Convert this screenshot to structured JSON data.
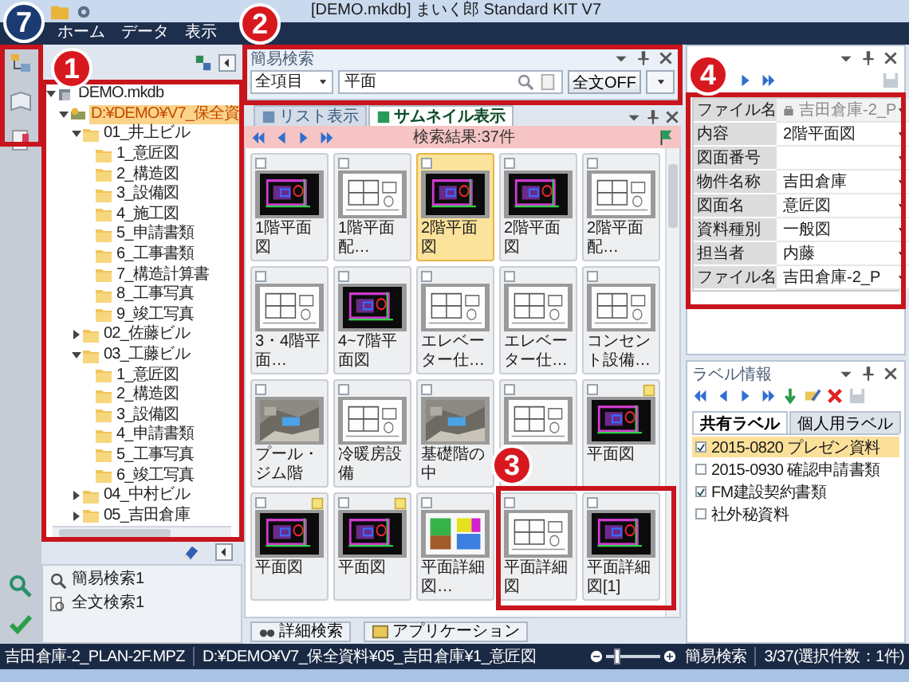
{
  "window": {
    "logo": "7",
    "title": "[DEMO.mkdb] まいく郎 Standard KIT V7"
  },
  "ribbon_tabs": [
    {
      "label": "ホーム",
      "selected": false
    },
    {
      "label": "データ",
      "selected": false
    },
    {
      "label": "表示",
      "selected": false
    }
  ],
  "tree": [
    {
      "label": "DEMO.mkdb",
      "kind": "db",
      "expanded": true,
      "selected": false,
      "children": [
        {
          "label": "D:¥DEMO¥V7_保全資",
          "kind": "drive",
          "expanded": true,
          "selected": true,
          "children": [
            {
              "label": "01_井上ビル",
              "kind": "folder",
              "expanded": true,
              "selected": false,
              "children": [
                {
                  "label": "1_意匠図",
                  "kind": "folder",
                  "selected": false
                },
                {
                  "label": "2_構造図",
                  "kind": "folder",
                  "selected": false
                },
                {
                  "label": "3_設備図",
                  "kind": "folder",
                  "selected": false
                },
                {
                  "label": "4_施工図",
                  "kind": "folder",
                  "selected": false
                },
                {
                  "label": "5_申請書類",
                  "kind": "folder",
                  "selected": false
                },
                {
                  "label": "6_工事書類",
                  "kind": "folder",
                  "selected": false
                },
                {
                  "label": "7_構造計算書",
                  "kind": "folder",
                  "selected": false
                },
                {
                  "label": "8_工事写真",
                  "kind": "folder",
                  "selected": false
                },
                {
                  "label": "9_竣工写真",
                  "kind": "folder",
                  "selected": false
                }
              ]
            },
            {
              "label": "02_佐藤ビル",
              "kind": "folder",
              "expanded": false,
              "selected": false
            },
            {
              "label": "03_工藤ビル",
              "kind": "folder",
              "expanded": true,
              "selected": false,
              "children": [
                {
                  "label": "1_意匠図",
                  "kind": "folder",
                  "selected": false
                },
                {
                  "label": "2_構造図",
                  "kind": "folder",
                  "selected": false
                },
                {
                  "label": "3_設備図",
                  "kind": "folder",
                  "selected": false
                },
                {
                  "label": "4_申請書類",
                  "kind": "folder",
                  "selected": false
                },
                {
                  "label": "5_工事写真",
                  "kind": "folder",
                  "selected": false
                },
                {
                  "label": "6_竣工写真",
                  "kind": "folder",
                  "selected": false
                }
              ]
            },
            {
              "label": "04_中村ビル",
              "kind": "folder",
              "expanded": false,
              "selected": false
            },
            {
              "label": "05_吉田倉庫",
              "kind": "folder",
              "expanded": false,
              "selected": false
            }
          ]
        }
      ]
    }
  ],
  "saved_searches": [
    {
      "label": "簡易検索1",
      "kind": "simple"
    },
    {
      "label": "全文検索1",
      "kind": "fulltext"
    }
  ],
  "search_panel": {
    "title": "簡易検索",
    "field": "全項目",
    "query": "平面",
    "fulltext_button": "全文OFF"
  },
  "view_tabs": [
    {
      "label": "リスト表示",
      "selected": false
    },
    {
      "label": "サムネイル表示",
      "selected": true
    }
  ],
  "result_count": "検索結果:37件",
  "thumbnails": [
    {
      "label": "1階平面図",
      "kind": "cad-dark",
      "selected": false,
      "checked": false,
      "note": false
    },
    {
      "label": "1階平面配…",
      "kind": "cad-white",
      "selected": false,
      "checked": false,
      "note": false
    },
    {
      "label": "2階平面図",
      "kind": "cad-dark",
      "selected": true,
      "checked": false,
      "note": false
    },
    {
      "label": "2階平面図",
      "kind": "cad-dark",
      "selected": false,
      "checked": false,
      "note": false
    },
    {
      "label": "2階平面配…",
      "kind": "cad-white",
      "selected": false,
      "checked": false,
      "note": false
    },
    {
      "label": "3・4階平面…",
      "kind": "cad-white",
      "selected": false,
      "checked": false,
      "note": false
    },
    {
      "label": "4~7階平面図",
      "kind": "cad-dark",
      "selected": false,
      "checked": false,
      "note": false
    },
    {
      "label": "エレベーター仕…",
      "kind": "cad-white",
      "selected": false,
      "checked": false,
      "note": false
    },
    {
      "label": "エレベーター仕…",
      "kind": "cad-white",
      "selected": false,
      "checked": false,
      "note": false
    },
    {
      "label": "コンセント設備…",
      "kind": "cad-white",
      "selected": false,
      "checked": false,
      "note": false
    },
    {
      "label": "プール・ジム階",
      "selected": false,
      "checked": false,
      "note": false
    },
    {
      "label": "冷暖房設備",
      "kind": "cad-white",
      "selected": false,
      "checked": false,
      "note": false
    },
    {
      "label": "基礎階の中",
      "selected": false,
      "checked": false,
      "note": false
    },
    {
      "kind": "cad-white",
      "selected": false,
      "checked": false,
      "note": false
    },
    {
      "label": "平面図",
      "kind": "cad-dark",
      "selected": false,
      "checked": false,
      "note": true
    },
    {
      "label": "平面図",
      "kind": "cad-dark",
      "selected": false,
      "checked": false,
      "note": true
    },
    {
      "label": "平面図",
      "kind": "cad-dark",
      "selected": false,
      "checked": false,
      "note": true
    },
    {
      "label": "平面詳細図…",
      "kind": "color-plan",
      "selected": false,
      "checked": false,
      "note": false
    },
    {
      "label": "平面詳細図",
      "kind": "cad-white",
      "selected": false,
      "checked": false,
      "note": false
    },
    {
      "label": "平面詳細図[1]",
      "kind": "cad-dark",
      "selected": false,
      "checked": false,
      "note": false
    }
  ],
  "bottom_tabs": [
    {
      "label": "詳細検索",
      "kind": "search"
    },
    {
      "label": "アプリケーション",
      "kind": "app"
    }
  ],
  "properties": [
    {
      "name": "ファイル名",
      "value": "吉田倉庫-2_P",
      "disabled": true
    },
    {
      "name": "内容",
      "value": "2階平面図",
      "disabled": false
    },
    {
      "name": "図面番号",
      "disabled": false
    },
    {
      "name": "物件名称",
      "value": "吉田倉庫",
      "disabled": false
    },
    {
      "name": "図面名",
      "value": "意匠図",
      "disabled": false
    },
    {
      "name": "資料種別",
      "value": "一般図",
      "disabled": false
    },
    {
      "name": "担当者",
      "value": "内藤",
      "disabled": false
    },
    {
      "name": "ファイル名",
      "value": "吉田倉庫-2_P",
      "disabled": false
    }
  ],
  "label_panel": {
    "title": "ラベル情報",
    "tabs": [
      {
        "label": "共有ラベル",
        "selected": true
      },
      {
        "label": "個人用ラベル",
        "selected": false
      }
    ],
    "labels": [
      {
        "label": "2015-0820 プレゼン資料",
        "checked": true,
        "selected": true
      },
      {
        "label": "2015-0930 確認申請書類",
        "checked": false,
        "selected": false
      },
      {
        "label": "FM建設契約書類",
        "checked": true,
        "selected": false
      },
      {
        "label": "社外秘資料",
        "checked": false,
        "selected": false
      }
    ]
  },
  "status_bar": {
    "file": "吉田倉庫-2_PLAN-2F.MPZ",
    "path": "D:¥DEMO¥V7_保全資料¥05_吉田倉庫¥1_意匠図",
    "level": 0.2,
    "mode": "簡易検索",
    "count": "3/37(選択件数：1件)"
  },
  "callouts": [
    {
      "number": "1"
    },
    {
      "number": "2"
    },
    {
      "number": "3"
    },
    {
      "number": "4"
    }
  ]
}
